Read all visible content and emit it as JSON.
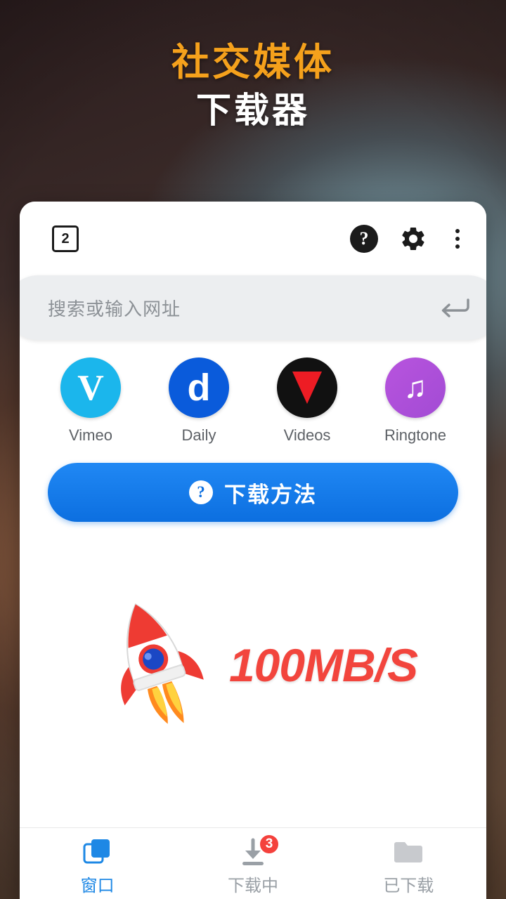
{
  "hero": {
    "line1": "社交媒体",
    "line2": "下载器",
    "line1_color": "#F5A11C",
    "line2_color": "#FFFFFF"
  },
  "browser": {
    "topbar": {
      "tab_count": "2",
      "help_glyph": "?",
      "icons": [
        "tab-count",
        "help-icon",
        "gear-icon",
        "more-vertical-icon"
      ]
    },
    "search": {
      "placeholder": "搜索或输入网址",
      "value": "",
      "enter_icon": "enter-arrow-icon"
    },
    "shortcuts": [
      {
        "label": "Vimeo",
        "glyph": "V",
        "color": "#1BB6EC"
      },
      {
        "label": "Daily",
        "glyph": "d",
        "color": "#0A5BDB"
      },
      {
        "label": "Videos",
        "glyph": "▶",
        "color": "#111111"
      },
      {
        "label": "Ringtone",
        "glyph": "♫",
        "color": "#B854DE"
      }
    ],
    "download_method": {
      "label": "下载方法",
      "icon": "question-mark-icon",
      "color": "#0C6FE0"
    },
    "promo": {
      "speed": "100MB/S",
      "speed_color": "#F2453D",
      "icon": "rocket-icon"
    },
    "bottom_nav": [
      {
        "label": "窗口",
        "icon": "windows-icon",
        "active": true,
        "badge": ""
      },
      {
        "label": "下载中",
        "icon": "download-icon",
        "active": false,
        "badge": "3"
      },
      {
        "label": "已下载",
        "icon": "folder-icon",
        "active": false,
        "badge": ""
      }
    ]
  }
}
